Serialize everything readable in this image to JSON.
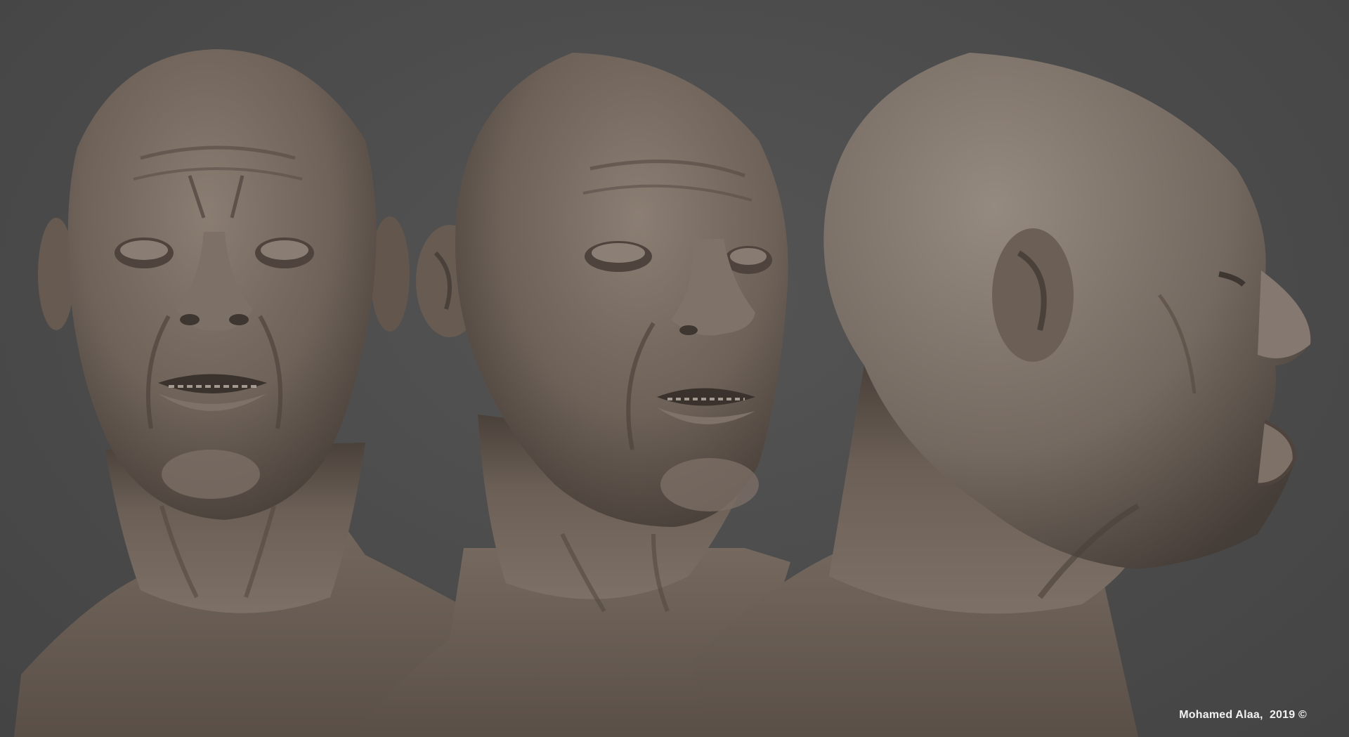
{
  "credit": {
    "author": "Mohamed Alaa,",
    "year": "2019",
    "symbol": "©"
  },
  "render": {
    "background_color": "#4d4d4d",
    "clay_color": "#6e6259",
    "views": [
      "front",
      "three-quarter",
      "profile"
    ]
  }
}
